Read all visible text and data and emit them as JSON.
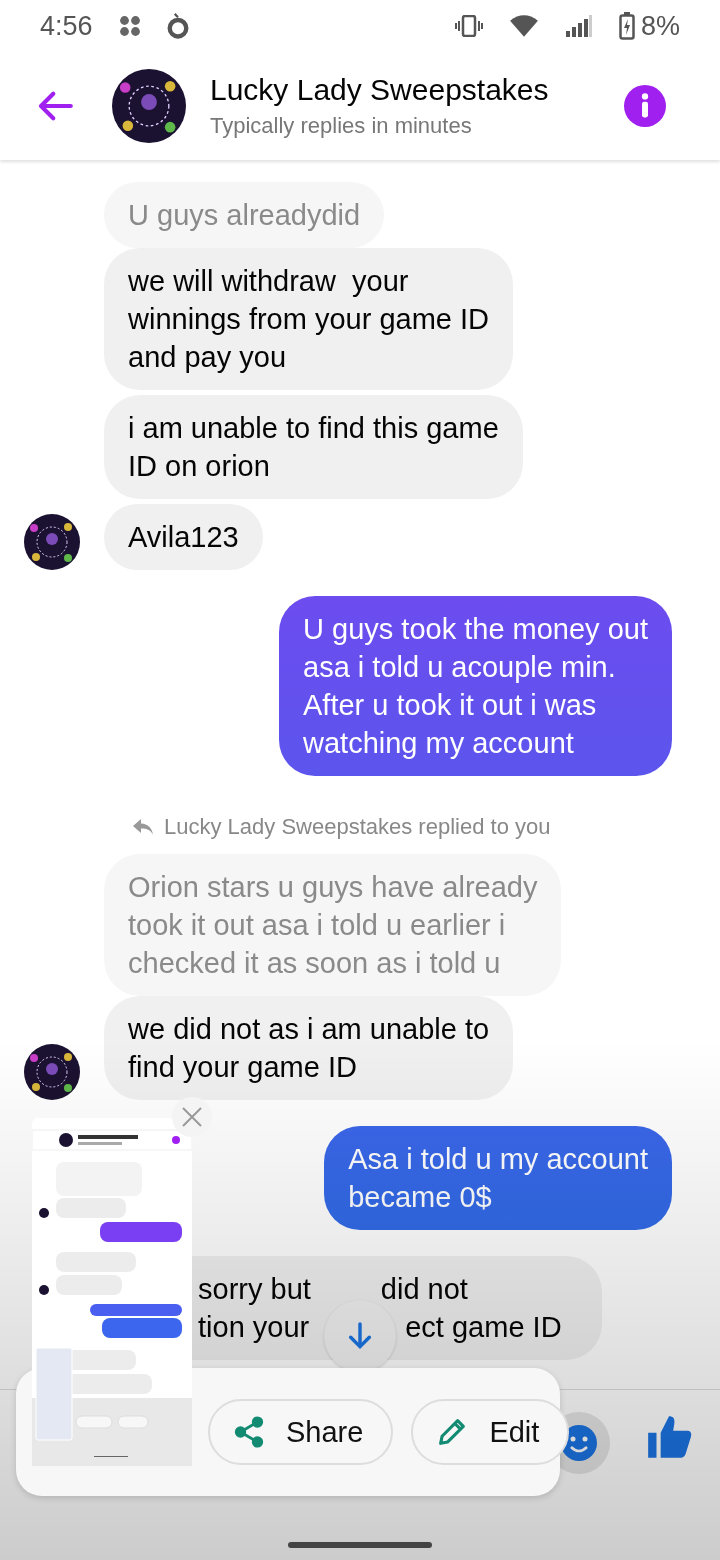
{
  "status_bar": {
    "time": "4:56",
    "battery": "8%"
  },
  "header": {
    "title": "Lucky Lady Sweepstakes",
    "subtitle": "Typically replies in minutes"
  },
  "messages": [
    {
      "kind": "quoted",
      "lines": [
        "U guys alreadydid"
      ]
    },
    {
      "kind": "received",
      "lines": [
        "we will withdraw  your",
        "winnings from your game ID",
        "and pay you"
      ],
      "avatar": false
    },
    {
      "kind": "received",
      "lines": [
        "i am unable to find this game",
        "ID on orion"
      ],
      "avatar": false
    },
    {
      "kind": "received",
      "lines": [
        "Avila123"
      ],
      "avatar": true
    },
    {
      "kind": "sent",
      "lines": [
        "U guys took the money out",
        "asa i told u acouple min.",
        "After u took it out i was",
        "watching my account"
      ]
    },
    {
      "kind": "reply_label",
      "lines": [
        "Lucky Lady Sweepstakes replied to you"
      ]
    },
    {
      "kind": "quoted",
      "lines": [
        "Orion stars u guys have already",
        "took it out asa i told u earlier i",
        "checked it as soon as i told u"
      ]
    },
    {
      "kind": "received",
      "lines": [
        "we did not as i am unable to",
        "find your game ID"
      ],
      "avatar": true
    },
    {
      "kind": "sent",
      "lines": [
        "Asa i told u my account",
        "became 0$"
      ]
    },
    {
      "kind": "partial",
      "parts": [
        [
          "sorry but",
          "did not"
        ],
        [
          "tion your",
          "ect game ID"
        ]
      ]
    }
  ],
  "share_sheet": {
    "share": "Share",
    "edit": "Edit"
  }
}
